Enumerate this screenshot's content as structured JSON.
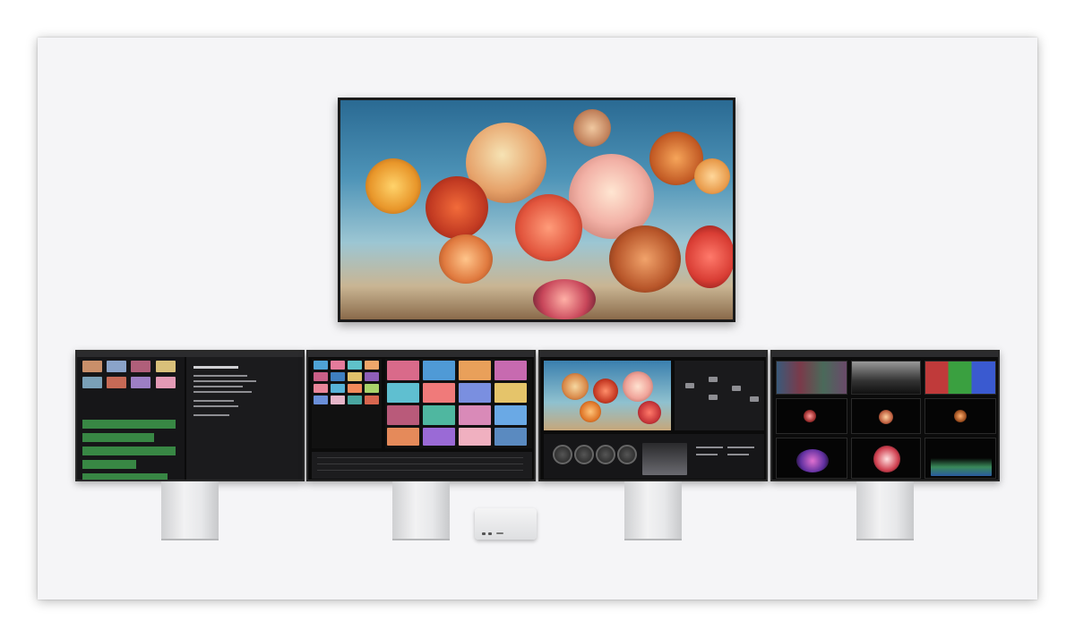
{
  "scene": {
    "items": [
      {
        "name": "tv-display",
        "content": "floral-3d-artwork"
      },
      {
        "name": "monitor-1",
        "content": "audio-editing-app"
      },
      {
        "name": "monitor-2",
        "content": "media-browser-app"
      },
      {
        "name": "monitor-3",
        "content": "color-grading-app"
      },
      {
        "name": "monitor-4",
        "content": "video-scopes-app"
      },
      {
        "name": "desktop-computer",
        "content": "compact-desktop"
      }
    ]
  },
  "colors": {
    "background": "#f5f5f7",
    "bezel": "#0b0b0b",
    "stand": "#e7e8ea",
    "accent_green": "#3e9b4c"
  }
}
